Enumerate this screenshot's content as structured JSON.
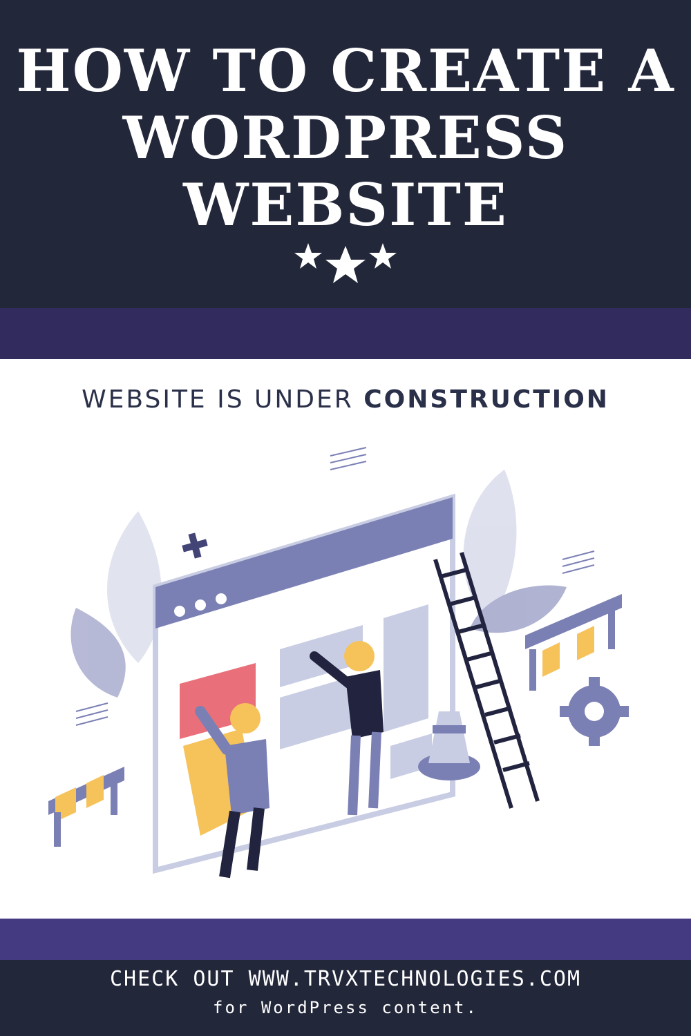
{
  "header": {
    "title_lines": [
      "HOW TO CREATE A",
      "WORDPRESS",
      "WEBSITE"
    ],
    "decoration": "three-stars-icon"
  },
  "banner": {
    "heading_regular": "WEBSITE IS UNDER ",
    "heading_bold": "CONSTRUCTION"
  },
  "illustration": {
    "subject": "isometric-website-construction",
    "colors": {
      "primary": "#7b80b4",
      "light": "#c9cde3",
      "accent_yellow": "#f6c25a",
      "accent_red": "#e9707a",
      "dark": "#22243f"
    }
  },
  "footer": {
    "line1": "CHECK OUT WWW.TRVXTECHNOLOGIES.COM",
    "line2": "for WordPress content."
  },
  "colors": {
    "header_bg": "#23273a",
    "band_top": "#322b5e",
    "band_bottom": "#433a82",
    "text_light": "#ffffff",
    "text_dark": "#2a3049"
  }
}
